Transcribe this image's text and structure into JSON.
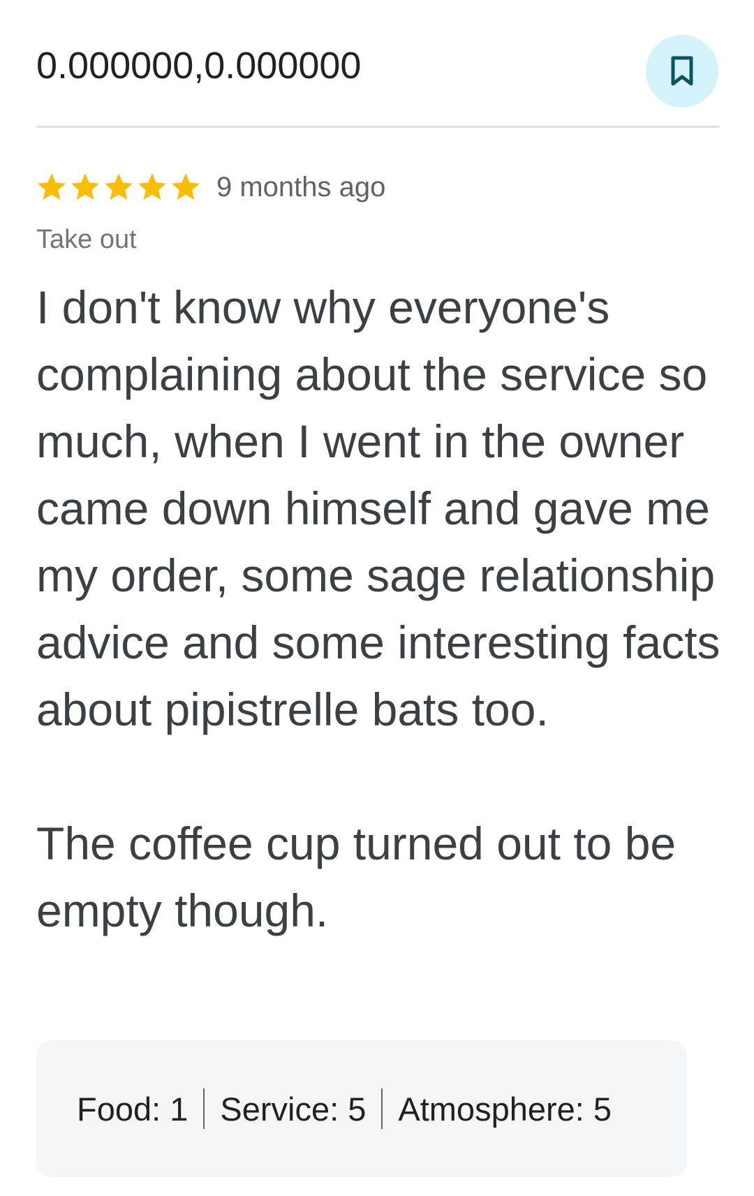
{
  "location": {
    "coordinates": "0.000000,0.000000"
  },
  "review": {
    "rating": 5,
    "max_rating": 5,
    "time_ago": "9 months ago",
    "service_type": "Take out",
    "paragraphs": [
      "I don't know why everyone's complaining about the service so much, when I went in the owner came down himself and gave me my order, some sage relationship advice and some interesting facts about pipistrelle bats too.",
      "The coffee cup turned out to be empty though."
    ],
    "sub_ratings": [
      {
        "label": "Food:",
        "value": "1"
      },
      {
        "label": "Service:",
        "value": "5"
      },
      {
        "label": "Atmosphere:",
        "value": "5"
      }
    ]
  },
  "icons": {
    "save": "bookmark-icon",
    "star": "star-icon"
  },
  "colors": {
    "star": "#fbbc04",
    "save_button_bg": "#d5f3fa",
    "save_icon": "#0b5563",
    "ratings_box_bg": "#f5f6f7"
  }
}
